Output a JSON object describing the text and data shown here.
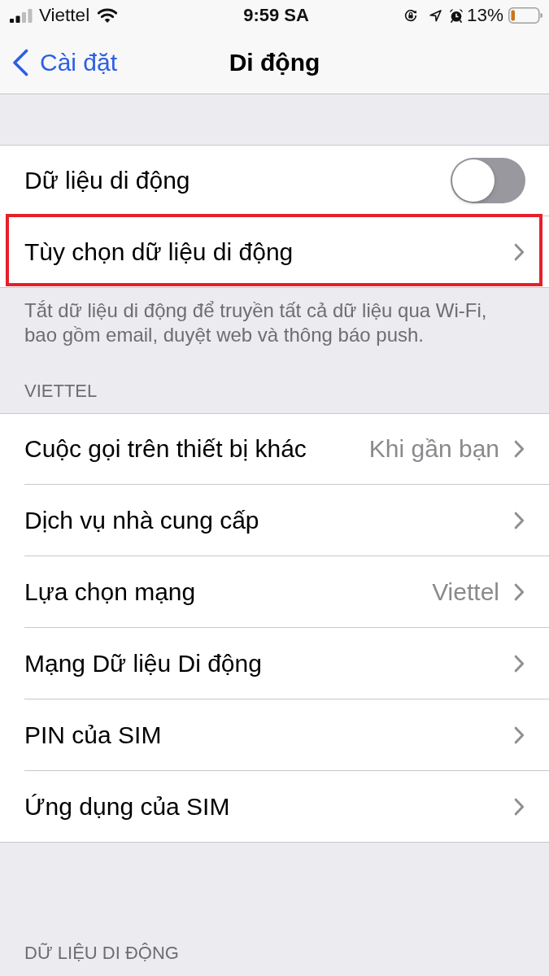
{
  "status_bar": {
    "carrier": "Viettel",
    "time": "9:59 SA",
    "battery": "13%"
  },
  "nav_bar": {
    "back": "Cài đặt",
    "title": "Di động"
  },
  "sections": [
    {
      "rows": [
        {
          "kind": "toggle",
          "label": "Dữ liệu di động",
          "on": false,
          "highlighted": false
        },
        {
          "kind": "link",
          "label": "Tùy chọn dữ liệu di động",
          "highlighted": true
        }
      ],
      "footer": "Tắt dữ liệu di động để truyền tất cả dữ liệu qua Wi-Fi, bao gồm email, duyệt web và thông báo push."
    },
    {
      "header": "VIETTEL",
      "rows": [
        {
          "kind": "link",
          "label": "Cuộc gọi trên thiết bị khác",
          "value": "Khi gần bạn",
          "highlighted": false
        },
        {
          "kind": "link",
          "label": "Dịch vụ nhà cung cấp",
          "highlighted": false
        },
        {
          "kind": "link",
          "label": "Lựa chọn mạng",
          "value": "Viettel",
          "highlighted": false
        },
        {
          "kind": "link",
          "label": "Mạng Dữ liệu Di động",
          "highlighted": false
        },
        {
          "kind": "link",
          "label": "PIN của SIM",
          "highlighted": false
        },
        {
          "kind": "link",
          "label": "Ứng dụng của SIM",
          "highlighted": false
        }
      ]
    },
    {
      "header": "DỮ LIỆU DI ĐỘNG"
    }
  ]
}
